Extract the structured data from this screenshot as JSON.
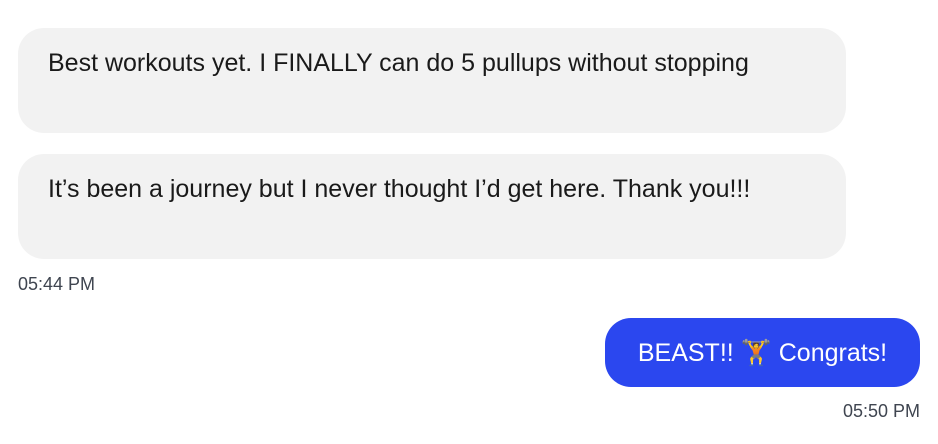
{
  "conversation": {
    "incoming": [
      {
        "text": "Best workouts yet. I FINALLY can do 5 pullups without stopping"
      },
      {
        "text": "It’s been a journey but I never thought I’d get here. Thank you!!!"
      }
    ],
    "incoming_time": "05:44 PM",
    "outgoing": {
      "text": "BEAST!! 🏋️ Congrats!"
    },
    "outgoing_time": "05:50 PM"
  },
  "colors": {
    "incoming_bubble": "#f2f2f2",
    "outgoing_bubble": "#2b47ef",
    "timestamp": "#3f4550"
  }
}
